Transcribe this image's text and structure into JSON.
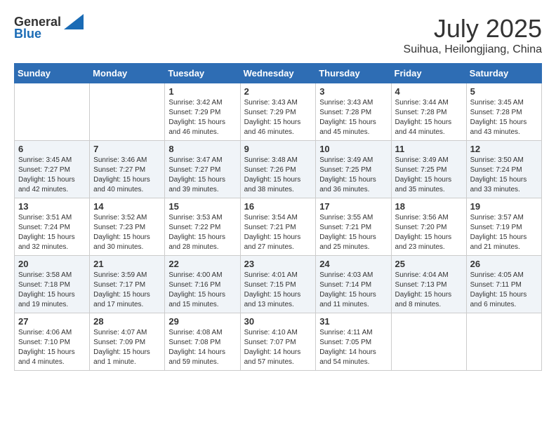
{
  "header": {
    "logo_general": "General",
    "logo_blue": "Blue",
    "month": "July 2025",
    "location": "Suihuа, Heilongjiang, China"
  },
  "weekdays": [
    "Sunday",
    "Monday",
    "Tuesday",
    "Wednesday",
    "Thursday",
    "Friday",
    "Saturday"
  ],
  "weeks": [
    [
      {
        "day": "",
        "info": ""
      },
      {
        "day": "",
        "info": ""
      },
      {
        "day": "1",
        "info": "Sunrise: 3:42 AM\nSunset: 7:29 PM\nDaylight: 15 hours and 46 minutes."
      },
      {
        "day": "2",
        "info": "Sunrise: 3:43 AM\nSunset: 7:29 PM\nDaylight: 15 hours and 46 minutes."
      },
      {
        "day": "3",
        "info": "Sunrise: 3:43 AM\nSunset: 7:28 PM\nDaylight: 15 hours and 45 minutes."
      },
      {
        "day": "4",
        "info": "Sunrise: 3:44 AM\nSunset: 7:28 PM\nDaylight: 15 hours and 44 minutes."
      },
      {
        "day": "5",
        "info": "Sunrise: 3:45 AM\nSunset: 7:28 PM\nDaylight: 15 hours and 43 minutes."
      }
    ],
    [
      {
        "day": "6",
        "info": "Sunrise: 3:45 AM\nSunset: 7:27 PM\nDaylight: 15 hours and 42 minutes."
      },
      {
        "day": "7",
        "info": "Sunrise: 3:46 AM\nSunset: 7:27 PM\nDaylight: 15 hours and 40 minutes."
      },
      {
        "day": "8",
        "info": "Sunrise: 3:47 AM\nSunset: 7:27 PM\nDaylight: 15 hours and 39 minutes."
      },
      {
        "day": "9",
        "info": "Sunrise: 3:48 AM\nSunset: 7:26 PM\nDaylight: 15 hours and 38 minutes."
      },
      {
        "day": "10",
        "info": "Sunrise: 3:49 AM\nSunset: 7:25 PM\nDaylight: 15 hours and 36 minutes."
      },
      {
        "day": "11",
        "info": "Sunrise: 3:49 AM\nSunset: 7:25 PM\nDaylight: 15 hours and 35 minutes."
      },
      {
        "day": "12",
        "info": "Sunrise: 3:50 AM\nSunset: 7:24 PM\nDaylight: 15 hours and 33 minutes."
      }
    ],
    [
      {
        "day": "13",
        "info": "Sunrise: 3:51 AM\nSunset: 7:24 PM\nDaylight: 15 hours and 32 minutes."
      },
      {
        "day": "14",
        "info": "Sunrise: 3:52 AM\nSunset: 7:23 PM\nDaylight: 15 hours and 30 minutes."
      },
      {
        "day": "15",
        "info": "Sunrise: 3:53 AM\nSunset: 7:22 PM\nDaylight: 15 hours and 28 minutes."
      },
      {
        "day": "16",
        "info": "Sunrise: 3:54 AM\nSunset: 7:21 PM\nDaylight: 15 hours and 27 minutes."
      },
      {
        "day": "17",
        "info": "Sunrise: 3:55 AM\nSunset: 7:21 PM\nDaylight: 15 hours and 25 minutes."
      },
      {
        "day": "18",
        "info": "Sunrise: 3:56 AM\nSunset: 7:20 PM\nDaylight: 15 hours and 23 minutes."
      },
      {
        "day": "19",
        "info": "Sunrise: 3:57 AM\nSunset: 7:19 PM\nDaylight: 15 hours and 21 minutes."
      }
    ],
    [
      {
        "day": "20",
        "info": "Sunrise: 3:58 AM\nSunset: 7:18 PM\nDaylight: 15 hours and 19 minutes."
      },
      {
        "day": "21",
        "info": "Sunrise: 3:59 AM\nSunset: 7:17 PM\nDaylight: 15 hours and 17 minutes."
      },
      {
        "day": "22",
        "info": "Sunrise: 4:00 AM\nSunset: 7:16 PM\nDaylight: 15 hours and 15 minutes."
      },
      {
        "day": "23",
        "info": "Sunrise: 4:01 AM\nSunset: 7:15 PM\nDaylight: 15 hours and 13 minutes."
      },
      {
        "day": "24",
        "info": "Sunrise: 4:03 AM\nSunset: 7:14 PM\nDaylight: 15 hours and 11 minutes."
      },
      {
        "day": "25",
        "info": "Sunrise: 4:04 AM\nSunset: 7:13 PM\nDaylight: 15 hours and 8 minutes."
      },
      {
        "day": "26",
        "info": "Sunrise: 4:05 AM\nSunset: 7:11 PM\nDaylight: 15 hours and 6 minutes."
      }
    ],
    [
      {
        "day": "27",
        "info": "Sunrise: 4:06 AM\nSunset: 7:10 PM\nDaylight: 15 hours and 4 minutes."
      },
      {
        "day": "28",
        "info": "Sunrise: 4:07 AM\nSunset: 7:09 PM\nDaylight: 15 hours and 1 minute."
      },
      {
        "day": "29",
        "info": "Sunrise: 4:08 AM\nSunset: 7:08 PM\nDaylight: 14 hours and 59 minutes."
      },
      {
        "day": "30",
        "info": "Sunrise: 4:10 AM\nSunset: 7:07 PM\nDaylight: 14 hours and 57 minutes."
      },
      {
        "day": "31",
        "info": "Sunrise: 4:11 AM\nSunset: 7:05 PM\nDaylight: 14 hours and 54 minutes."
      },
      {
        "day": "",
        "info": ""
      },
      {
        "day": "",
        "info": ""
      }
    ]
  ]
}
